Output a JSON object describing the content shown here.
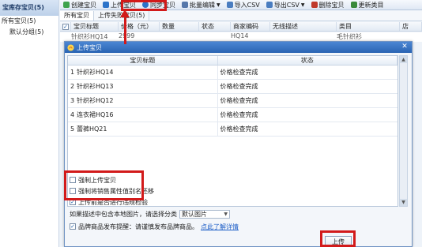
{
  "sidebar": {
    "title": "宝库存宝贝(5)",
    "items": [
      {
        "label": "所有宝贝(5)"
      },
      {
        "label": "默认分组(5)"
      }
    ]
  },
  "toolbar": {
    "buttons": [
      {
        "label": "创建宝贝",
        "color": "#3fa34d"
      },
      {
        "label": "上传宝贝",
        "color": "#2c73c9"
      },
      {
        "label": "同步宝贝",
        "color": "#2c73c9"
      },
      {
        "label": "批量编辑",
        "color": "#5577aa"
      },
      {
        "label": "导入CSV",
        "color": "#4a7dc0"
      },
      {
        "label": "导出CSV",
        "color": "#4a7dc0"
      },
      {
        "label": "删除宝贝",
        "color": "#c0392b"
      },
      {
        "label": "更新类目",
        "color": "#3a8a3a"
      }
    ]
  },
  "tabs": [
    "所有宝贝",
    "上传失败宝贝(5)"
  ],
  "grid": {
    "headers": [
      "宝贝标题",
      "价格（元）",
      "数量",
      "状态",
      "商家编码",
      "无线描述",
      "类目",
      "店"
    ],
    "first_row": [
      "针织衫HQ14",
      "2999",
      "",
      "",
      "HQ14",
      "",
      "毛针织衫"
    ]
  },
  "dialog": {
    "title": "上传宝贝",
    "columns": [
      "宝贝标题",
      "状态"
    ],
    "rows": [
      {
        "num": "1",
        "title": "针织衫HQ14",
        "status": "价格检查完成"
      },
      {
        "num": "2",
        "title": "针织衫HQ13",
        "status": "价格检查完成"
      },
      {
        "num": "3",
        "title": "针织衫HQ12",
        "status": "价格检查完成"
      },
      {
        "num": "4",
        "title": "连衣裙HQ16",
        "status": "价格检查完成"
      },
      {
        "num": "5",
        "title": "蕾裤HQ21",
        "status": "价格检查完成"
      }
    ],
    "options": {
      "force_upload": "强制上传宝贝",
      "force_clear_attr": "强制将销售属性值别名还移",
      "check_before_upload": "上传前是否进行违规检验",
      "image_hint": "如果描述中包含本地图片，请选择分类",
      "image_select": "默认图片",
      "brand_hint": "品牌商品发布提醒：请谨慎发布品牌商品。",
      "brand_link": "点此了解详情"
    },
    "upload_button": "上传"
  },
  "colors": {
    "annotation_red": "#d21a1a",
    "title_blue": "#2a64b3"
  }
}
